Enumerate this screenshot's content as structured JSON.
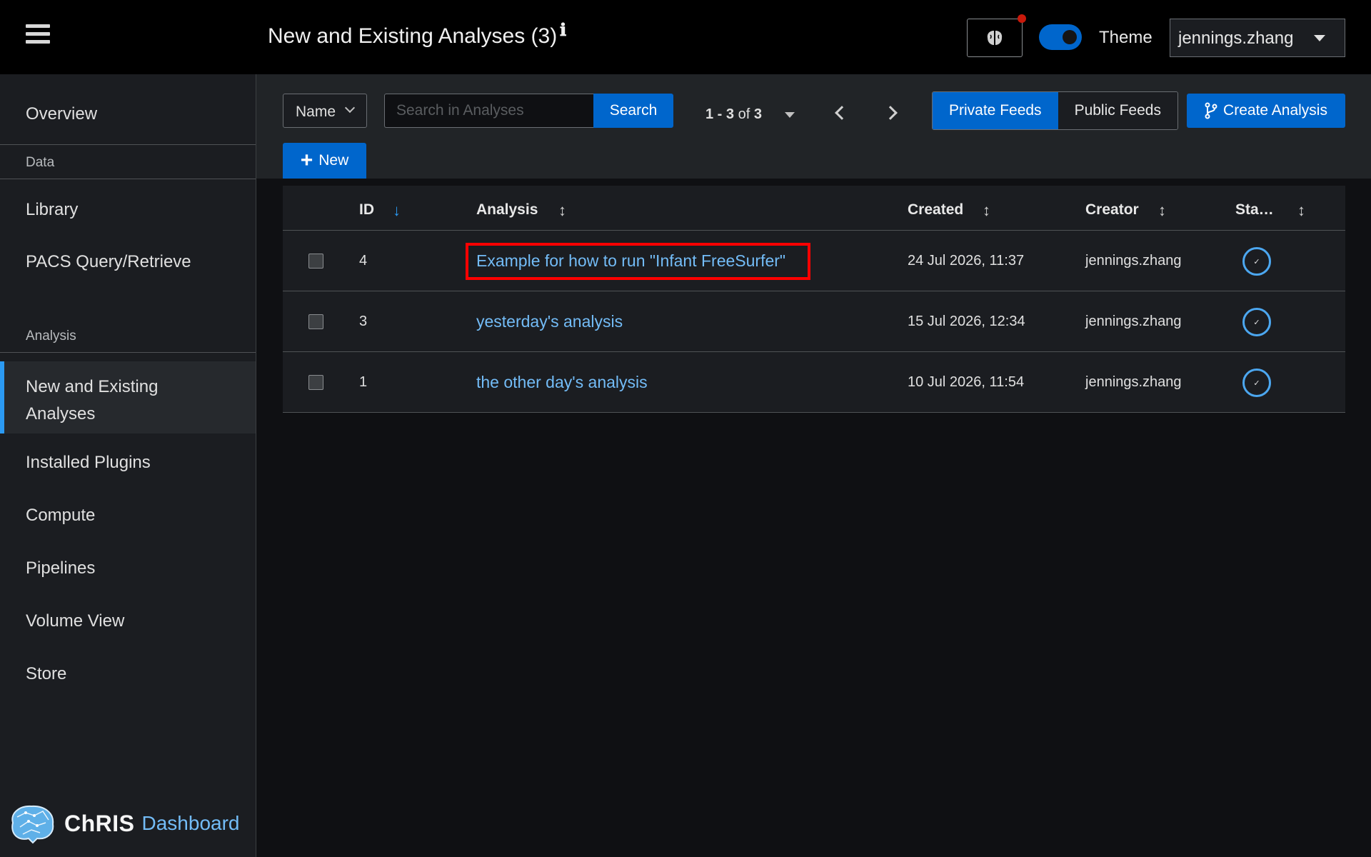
{
  "header": {
    "title": "New and Existing Analyses (3)",
    "info_icon": "info-icon",
    "theme_label": "Theme",
    "username": "jennings.zhang"
  },
  "sidebar": {
    "items": [
      {
        "label": "Overview"
      },
      {
        "section": "Data"
      },
      {
        "label": "Library"
      },
      {
        "label": "PACS Query/Retrieve"
      },
      {
        "section": "Analysis"
      },
      {
        "label": "New and Existing Analyses",
        "active": true
      },
      {
        "label": "Installed Plugins"
      },
      {
        "label": "Compute"
      },
      {
        "label": "Pipelines"
      },
      {
        "label": "Volume View"
      },
      {
        "label": "Store"
      }
    ],
    "logo": {
      "bold": "ChRIS",
      "light": "Dashboard"
    }
  },
  "toolbar": {
    "filter_select": "Name",
    "search_placeholder": "Search in Analyses",
    "search_button": "Search",
    "pagination": {
      "range": "1 - 3",
      "of": "of",
      "total": "3"
    },
    "private_feeds": "Private Feeds",
    "public_feeds": "Public Feeds",
    "create_analysis": "Create Analysis",
    "new_button": "New"
  },
  "table": {
    "columns": [
      "ID",
      "Analysis",
      "Created",
      "Creator",
      "Sta…"
    ],
    "rows": [
      {
        "id": "4",
        "analysis": "Example for how to run \"Infant FreeSurfer\"",
        "created": "24 Jul 2026, 11:37",
        "creator": "jennings.zhang",
        "status": "✓"
      },
      {
        "id": "3",
        "analysis": "yesterday's analysis",
        "created": "15 Jul 2026, 12:34",
        "creator": "jennings.zhang",
        "status": "✓"
      },
      {
        "id": "1",
        "analysis": "the other day's analysis",
        "created": "10 Jul 2026, 11:54",
        "creator": "jennings.zhang",
        "status": "✓"
      }
    ]
  },
  "colors": {
    "accent": "#0066cc",
    "link": "#73bcf7",
    "highlight": "#ff0000",
    "notification": "#c9190b"
  }
}
